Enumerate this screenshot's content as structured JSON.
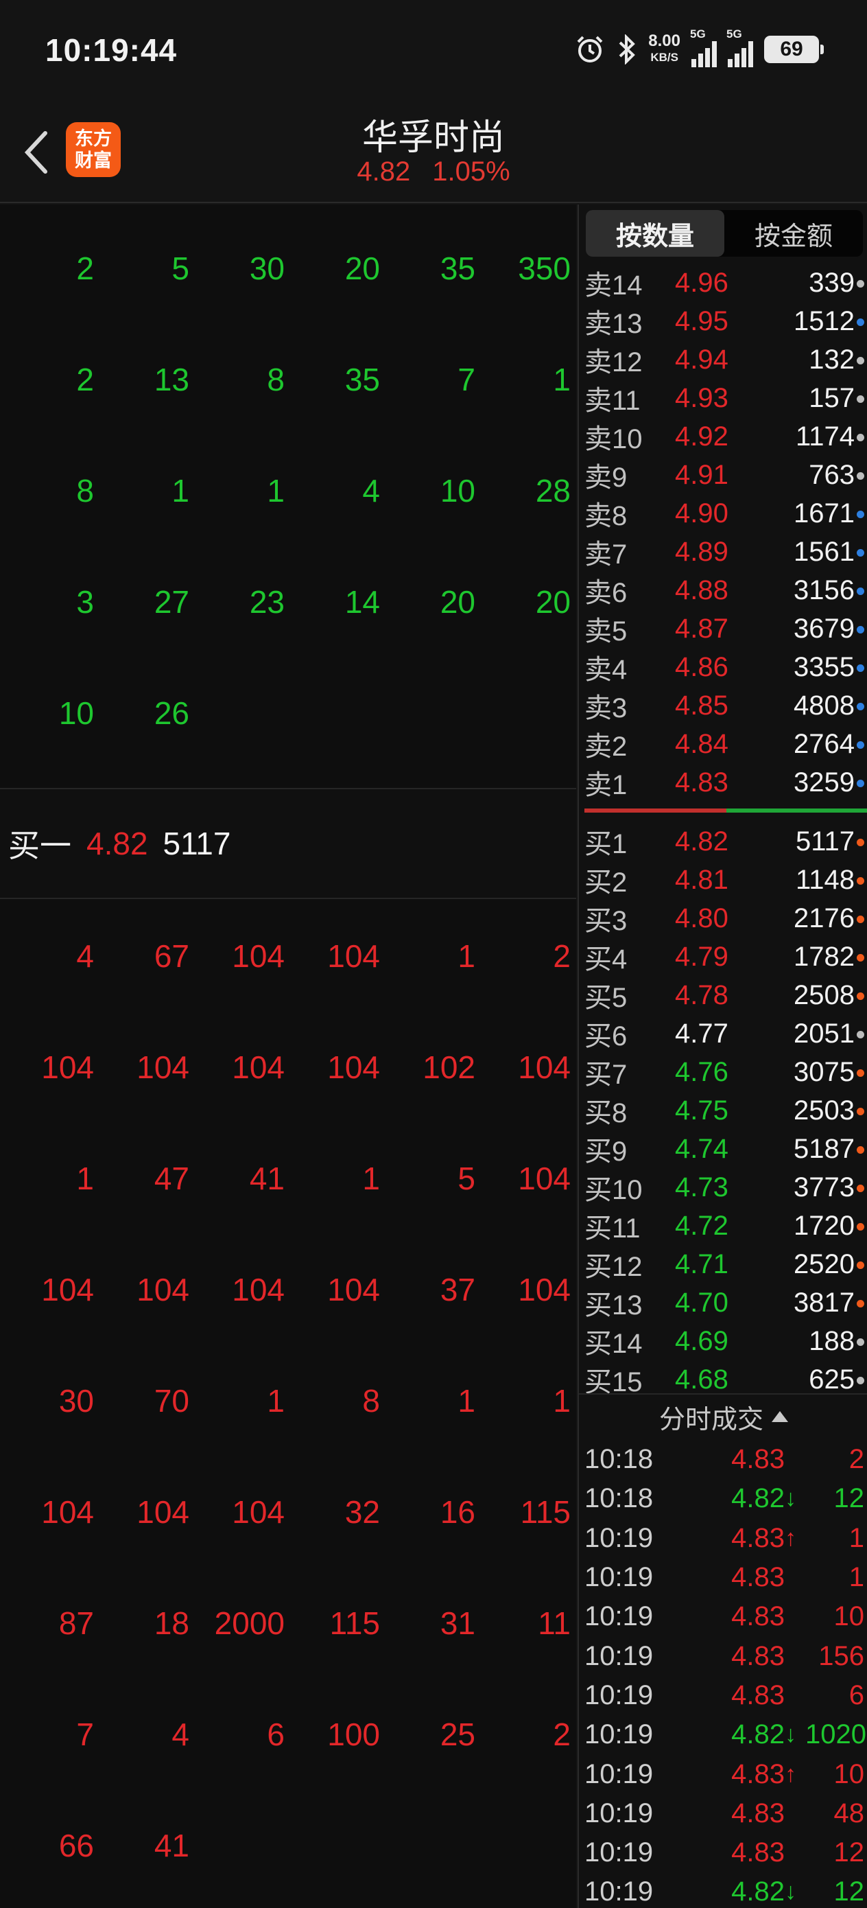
{
  "status_bar": {
    "time": "10:19:44",
    "net_speed": "8.00",
    "net_unit": "KB/S",
    "sim1": "5G",
    "sim2": "5G",
    "battery": "69"
  },
  "header": {
    "logo_line1": "东方",
    "logo_line2": "财富",
    "stock_name": "华孚时尚",
    "price": "4.82",
    "change_pct": "1.05%"
  },
  "sell_queue": [
    [
      "2",
      "5",
      "30",
      "20",
      "35",
      "350"
    ],
    [
      "2",
      "13",
      "8",
      "35",
      "7",
      "1"
    ],
    [
      "8",
      "1",
      "1",
      "4",
      "10",
      "28"
    ],
    [
      "3",
      "27",
      "23",
      "14",
      "20",
      "20"
    ],
    [
      "10",
      "26",
      "",
      "",
      "",
      ""
    ]
  ],
  "bid_bar": {
    "label": "买一",
    "price": "4.82",
    "volume": "5117"
  },
  "buy_queue": [
    [
      "4",
      "67",
      "104",
      "104",
      "1",
      "2"
    ],
    [
      "104",
      "104",
      "104",
      "104",
      "102",
      "104"
    ],
    [
      "1",
      "47",
      "41",
      "1",
      "5",
      "104"
    ],
    [
      "104",
      "104",
      "104",
      "104",
      "37",
      "104"
    ],
    [
      "30",
      "70",
      "1",
      "8",
      "1",
      "1"
    ],
    [
      "104",
      "104",
      "104",
      "32",
      "16",
      "115"
    ],
    [
      "87",
      "18",
      "2000",
      "115",
      "31",
      "11"
    ],
    [
      "7",
      "4",
      "6",
      "100",
      "25",
      "2"
    ],
    [
      "66",
      "41",
      "",
      "",
      "",
      ""
    ]
  ],
  "tabs": {
    "by_volume": "按数量",
    "by_amount": "按金额"
  },
  "colors": {
    "red": "#e3272a",
    "green": "#1ec72f",
    "white": "#f2f2f2",
    "dot_blue": "#2d7fe0",
    "dot_orange": "#f05a1a",
    "dot_gray": "#bdbdbd"
  },
  "asks": [
    {
      "label": "卖14",
      "price": "4.96",
      "volume": "339",
      "dot": "gray"
    },
    {
      "label": "卖13",
      "price": "4.95",
      "volume": "1512",
      "dot": "blue"
    },
    {
      "label": "卖12",
      "price": "4.94",
      "volume": "132",
      "dot": "gray"
    },
    {
      "label": "卖11",
      "price": "4.93",
      "volume": "157",
      "dot": "gray"
    },
    {
      "label": "卖10",
      "price": "4.92",
      "volume": "1174",
      "dot": "gray"
    },
    {
      "label": "卖9",
      "price": "4.91",
      "volume": "763",
      "dot": "gray"
    },
    {
      "label": "卖8",
      "price": "4.90",
      "volume": "1671",
      "dot": "blue"
    },
    {
      "label": "卖7",
      "price": "4.89",
      "volume": "1561",
      "dot": "blue"
    },
    {
      "label": "卖6",
      "price": "4.88",
      "volume": "3156",
      "dot": "blue"
    },
    {
      "label": "卖5",
      "price": "4.87",
      "volume": "3679",
      "dot": "blue"
    },
    {
      "label": "卖4",
      "price": "4.86",
      "volume": "3355",
      "dot": "blue"
    },
    {
      "label": "卖3",
      "price": "4.85",
      "volume": "4808",
      "dot": "blue"
    },
    {
      "label": "卖2",
      "price": "4.84",
      "volume": "2764",
      "dot": "blue"
    },
    {
      "label": "卖1",
      "price": "4.83",
      "volume": "3259",
      "dot": "blue"
    }
  ],
  "bids": [
    {
      "label": "买1",
      "price": "4.82",
      "volume": "5117",
      "dot": "orange",
      "tone": "red"
    },
    {
      "label": "买2",
      "price": "4.81",
      "volume": "1148",
      "dot": "orange",
      "tone": "red"
    },
    {
      "label": "买3",
      "price": "4.80",
      "volume": "2176",
      "dot": "orange",
      "tone": "red"
    },
    {
      "label": "买4",
      "price": "4.79",
      "volume": "1782",
      "dot": "orange",
      "tone": "red"
    },
    {
      "label": "买5",
      "price": "4.78",
      "volume": "2508",
      "dot": "orange",
      "tone": "red"
    },
    {
      "label": "买6",
      "price": "4.77",
      "volume": "2051",
      "dot": "gray",
      "tone": "white"
    },
    {
      "label": "买7",
      "price": "4.76",
      "volume": "3075",
      "dot": "orange",
      "tone": "green"
    },
    {
      "label": "买8",
      "price": "4.75",
      "volume": "2503",
      "dot": "orange",
      "tone": "green"
    },
    {
      "label": "买9",
      "price": "4.74",
      "volume": "5187",
      "dot": "orange",
      "tone": "green"
    },
    {
      "label": "买10",
      "price": "4.73",
      "volume": "3773",
      "dot": "orange",
      "tone": "green"
    },
    {
      "label": "买11",
      "price": "4.72",
      "volume": "1720",
      "dot": "orange",
      "tone": "green"
    },
    {
      "label": "买12",
      "price": "4.71",
      "volume": "2520",
      "dot": "orange",
      "tone": "green"
    },
    {
      "label": "买13",
      "price": "4.70",
      "volume": "3817",
      "dot": "orange",
      "tone": "green"
    },
    {
      "label": "买14",
      "price": "4.69",
      "volume": "188",
      "dot": "gray",
      "tone": "green"
    },
    {
      "label": "买15",
      "price": "4.68",
      "volume": "625",
      "dot": "gray",
      "tone": "green"
    }
  ],
  "trades_title": "分时成交",
  "trades": [
    {
      "time": "10:18",
      "price": "4.83",
      "arrow": "",
      "volume": "2",
      "tone": "red"
    },
    {
      "time": "10:18",
      "price": "4.82",
      "arrow": "↓",
      "volume": "12",
      "tone": "green"
    },
    {
      "time": "10:19",
      "price": "4.83",
      "arrow": "↑",
      "volume": "1",
      "tone": "red"
    },
    {
      "time": "10:19",
      "price": "4.83",
      "arrow": "",
      "volume": "1",
      "tone": "red"
    },
    {
      "time": "10:19",
      "price": "4.83",
      "arrow": "",
      "volume": "10",
      "tone": "red"
    },
    {
      "time": "10:19",
      "price": "4.83",
      "arrow": "",
      "volume": "156",
      "tone": "red"
    },
    {
      "time": "10:19",
      "price": "4.83",
      "arrow": "",
      "volume": "6",
      "tone": "red"
    },
    {
      "time": "10:19",
      "price": "4.82",
      "arrow": "↓",
      "volume": "1020",
      "tone": "green"
    },
    {
      "time": "10:19",
      "price": "4.83",
      "arrow": "↑",
      "volume": "10",
      "tone": "red"
    },
    {
      "time": "10:19",
      "price": "4.83",
      "arrow": "",
      "volume": "48",
      "tone": "red"
    },
    {
      "time": "10:19",
      "price": "4.83",
      "arrow": "",
      "volume": "12",
      "tone": "red"
    },
    {
      "time": "10:19",
      "price": "4.82",
      "arrow": "↓",
      "volume": "12",
      "tone": "green"
    }
  ]
}
